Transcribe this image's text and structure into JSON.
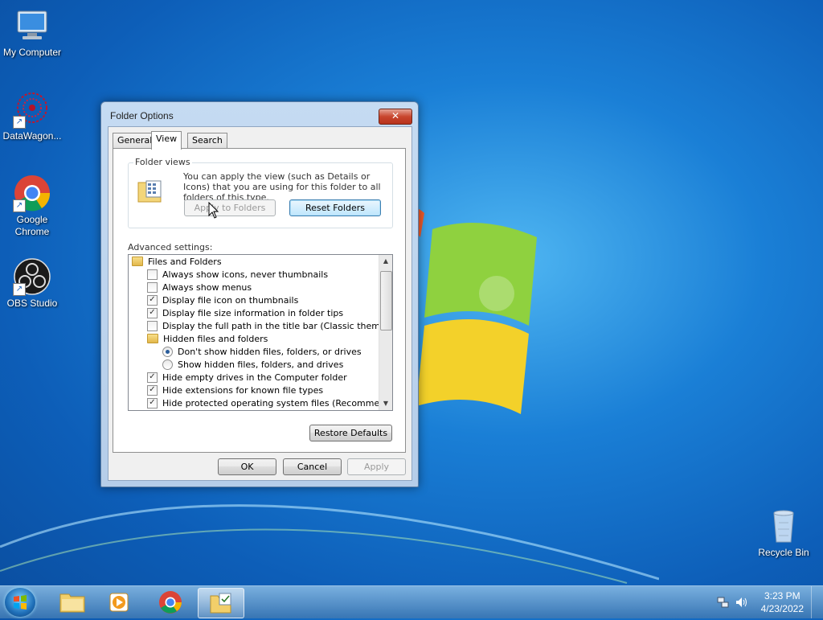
{
  "desktop": {
    "icons": [
      {
        "label": "My Computer",
        "icon": "computer-icon"
      },
      {
        "label": "DataWagon...",
        "icon": "datawagon-icon"
      },
      {
        "label": "Google Chrome",
        "icon": "chrome-icon"
      },
      {
        "label": "OBS Studio",
        "icon": "obs-icon"
      },
      {
        "label": "Recycle Bin",
        "icon": "recycle-bin-icon"
      }
    ]
  },
  "dialog": {
    "title": "Folder Options",
    "close_label": "✕",
    "tabs": [
      {
        "label": "General"
      },
      {
        "label": "View"
      },
      {
        "label": "Search"
      }
    ],
    "folder_views": {
      "label": "Folder views",
      "description": "You can apply the view (such as Details or Icons) that you are using for this folder to all folders of this type.",
      "apply_button": "Apply to Folders",
      "reset_button": "Reset Folders"
    },
    "advanced_label": "Advanced settings:",
    "advanced_items": [
      {
        "type": "folder",
        "label": "Files and Folders",
        "indent": 0
      },
      {
        "type": "checkbox",
        "label": "Always show icons, never thumbnails",
        "checked": false,
        "indent": 1
      },
      {
        "type": "checkbox",
        "label": "Always show menus",
        "checked": false,
        "indent": 1
      },
      {
        "type": "checkbox",
        "label": "Display file icon on thumbnails",
        "checked": true,
        "indent": 1
      },
      {
        "type": "checkbox",
        "label": "Display file size information in folder tips",
        "checked": true,
        "indent": 1
      },
      {
        "type": "checkbox",
        "label": "Display the full path in the title bar (Classic theme only)",
        "checked": false,
        "indent": 1
      },
      {
        "type": "folder",
        "label": "Hidden files and folders",
        "indent": 1
      },
      {
        "type": "radio",
        "label": "Don't show hidden files, folders, or drives",
        "checked": true,
        "indent": 2
      },
      {
        "type": "radio",
        "label": "Show hidden files, folders, and drives",
        "checked": false,
        "indent": 2
      },
      {
        "type": "checkbox",
        "label": "Hide empty drives in the Computer folder",
        "checked": true,
        "indent": 1
      },
      {
        "type": "checkbox",
        "label": "Hide extensions for known file types",
        "checked": true,
        "indent": 1
      },
      {
        "type": "checkbox",
        "label": "Hide protected operating system files (Recommended)",
        "checked": true,
        "indent": 1
      }
    ],
    "restore_defaults": "Restore Defaults",
    "ok": "OK",
    "cancel": "Cancel",
    "apply": "Apply"
  },
  "taskbar": {
    "time": "3:23 PM",
    "date": "4/23/2022",
    "buttons": [
      "explorer-icon",
      "media-player-icon",
      "chrome-icon",
      "folder-options-icon"
    ]
  }
}
